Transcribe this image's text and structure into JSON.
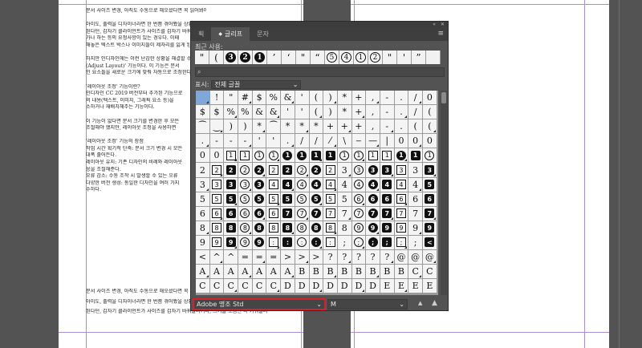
{
  "document": {
    "left_lines": [
      "문서 사이즈 변경, 아직도 수동으로 해오셨다면 꼭 읽어봐야 할 포스팅이다.",
      "",
      "아이도, 출력을 디자이너라면 한 번쯤 겪어봤을 상황이 있다.",
      "된다던, 갑자기 클라이언트가 사이즈를 갑자기 바꿔달라거나,",
      "가나 하는 등의 요청사항이 있는 경우다. 이때",
      "해놓은 텍스트 박스나 이미지들이 제자리를 잃게 된다.",
      "",
      "하지만 인디자인에는 이런 난감한 상황을 해결할 수 있는",
      "(Adjust Layout)' 기능이다. 이 기능은 문서",
      "인 요소들을 새로운 크기에 맞춰 자동으로 조정한다.",
      "",
      "'레이아웃 조정' 기능이란?",
      "인디자인 CC 2019 버전부터 추가된 기능으로",
      "의 내용(텍스트, 이미지, 그래픽 요소 등)을",
      "소하거나 재배치해주는 기능이다.",
      "",
      "이 기능이 없다면 문서 크기를 변경한 후 모든",
      "조절해야 했지만, 레이아웃 조정을 사용하면",
      "",
      "'레이아웃 조정' 기능의 장점",
      "작업 시간 획기적 단축: 문서 크기 변경 시 모든",
      "대폭 줄어든다.",
      "레이아웃 유지: 기존 디자인의 비례와 레이아웃",
      "응을 조절해준다.",
      "오류 감소: 수동 조작 시 발생할 수 있는 오류",
      "다양한 버전 생성: 동일한 디자인을 여러 가지",
      "수하다."
    ],
    "bottom_lines": [
      "문서 사이즈 변경, 아직도 수동으로 해오셨다면 꼭 읽어봐야 할 포스팅이다.",
      "아이도, 출력을 디자이너라면 한 번쯤 겪어봤을 상황이 있다. A4 사이즈로 디자인을 다 해",
      "된다던, 갑자기 클라이언트가 사이즈를 갑자기 바꿔달라거나, 크기를 조금만 더 키워달라"
    ]
  },
  "panel": {
    "tabs": [
      {
        "label": "획",
        "icon": ""
      },
      {
        "label": "글리프",
        "icon": "◆"
      },
      {
        "label": "문자",
        "icon": ""
      }
    ],
    "topbar_buttons": [
      "«",
      "✕"
    ],
    "menu_icon": "≡",
    "recent_label": "최근 사용:",
    "recent_glyphs": [
      {
        "ch": "\"",
        "kind": "plain"
      },
      {
        "ch": "(",
        "kind": "plain"
      },
      {
        "ch": "3",
        "kind": "dark"
      },
      {
        "ch": "2",
        "kind": "dark"
      },
      {
        "ch": "1",
        "kind": "dark"
      },
      {
        "ch": "’",
        "kind": "plain"
      },
      {
        "ch": "‘",
        "kind": "plain"
      },
      {
        "ch": "\"",
        "kind": "plain"
      },
      {
        "ch": "“",
        "kind": "plain"
      },
      {
        "ch": "5",
        "kind": "outline"
      },
      {
        "ch": "4",
        "kind": "outline"
      },
      {
        "ch": "1",
        "kind": "outline"
      },
      {
        "ch": "2",
        "kind": "outline"
      },
      {
        "ch": "\"",
        "kind": "plain"
      },
      {
        "ch": "'",
        "kind": "plain"
      },
      {
        "ch": "”",
        "kind": "plain"
      },
      {
        "ch": "",
        "kind": "plain"
      }
    ],
    "search_placeholder": "",
    "show_label": "표시:",
    "show_value": "전체 글꼴",
    "font_name": "Adobe 명조 Std",
    "font_style": "M",
    "glyph_rows": [
      [
        " ",
        "!",
        "\"",
        "#",
        "$",
        "%",
        "&",
        "'",
        "(",
        ")",
        "*",
        "+",
        ",",
        "-",
        ".",
        "/",
        "0"
      ],
      [
        "$",
        "$",
        "%",
        "%",
        "&",
        "&",
        "'",
        "'",
        "(",
        ")",
        "*",
        "+",
        ",",
        "-",
        ".",
        "/",
        "("
      ],
      [
        "⁀",
        "‿",
        ")",
        ")",
        "*",
        "⁀",
        "*",
        "*",
        "*",
        "+",
        "+",
        "+",
        ",",
        "-",
        ".",
        "(",
        "("
      ],
      [
        ".",
        "-",
        "-",
        "‐",
        "'",
        "'",
        ".",
        "/",
        "/",
        "⁄",
        "\\",
        "‒",
        "—",
        "|",
        "0",
        "0",
        "0"
      ],
      [
        "0",
        "0",
        "1",
        "1",
        "1",
        "1",
        "1",
        "1",
        "1",
        "1",
        "1",
        "1",
        "1",
        "1",
        "1",
        "1",
        "1"
      ],
      [
        "2",
        "2",
        "2",
        "2",
        "2",
        "2",
        "2",
        "2",
        "2",
        "2",
        "3",
        "3",
        "3",
        "3",
        "3",
        "3",
        "3"
      ],
      [
        "3",
        "3",
        "3",
        "3",
        "3",
        "4",
        "4",
        "4",
        "4",
        "4",
        "4",
        "4",
        "4",
        "4",
        "4",
        "4",
        "5"
      ],
      [
        "5",
        "5",
        "5",
        "5",
        "5",
        "5",
        "5",
        "5",
        "5",
        "5",
        "5",
        "6",
        "6",
        "6",
        "6",
        "6",
        "6"
      ],
      [
        "6",
        "6",
        "6",
        "6",
        "6",
        "6",
        "7",
        "7",
        "7",
        "7",
        "7",
        "7",
        "7",
        "7",
        "7",
        "7",
        "7"
      ],
      [
        "8",
        "8",
        "8",
        "8",
        "8",
        "8",
        "8",
        "8",
        "8",
        "8",
        "8",
        "9",
        "9",
        "9",
        "9",
        "9",
        "9"
      ],
      [
        "9",
        "9",
        "9",
        "9",
        "9",
        ":",
        ":",
        ":",
        ":",
        ":",
        ";",
        ";",
        ";",
        ";",
        ";",
        ";",
        "<"
      ],
      [
        "<",
        "^",
        "^",
        "=",
        "=",
        "=",
        ">",
        ">",
        ">",
        "?",
        "?",
        "?",
        "?",
        "?",
        "@",
        "@",
        "@"
      ],
      [
        "A",
        "A",
        "A",
        "A",
        "A",
        "A",
        "A",
        "B",
        "B",
        "B",
        "B",
        "B",
        "B",
        "B",
        "B",
        "C",
        "C"
      ],
      [
        "C",
        "C",
        "C",
        "C",
        "C",
        "C",
        "D",
        "D",
        "D",
        "D",
        "D",
        "D",
        "D",
        "E",
        "E",
        "E",
        "E"
      ]
    ]
  },
  "colors": {
    "canvas_bg": "#535353",
    "panel_bg": "#535353",
    "highlight_border": "#d8202a",
    "selected_cell": "#7fa7d9"
  }
}
